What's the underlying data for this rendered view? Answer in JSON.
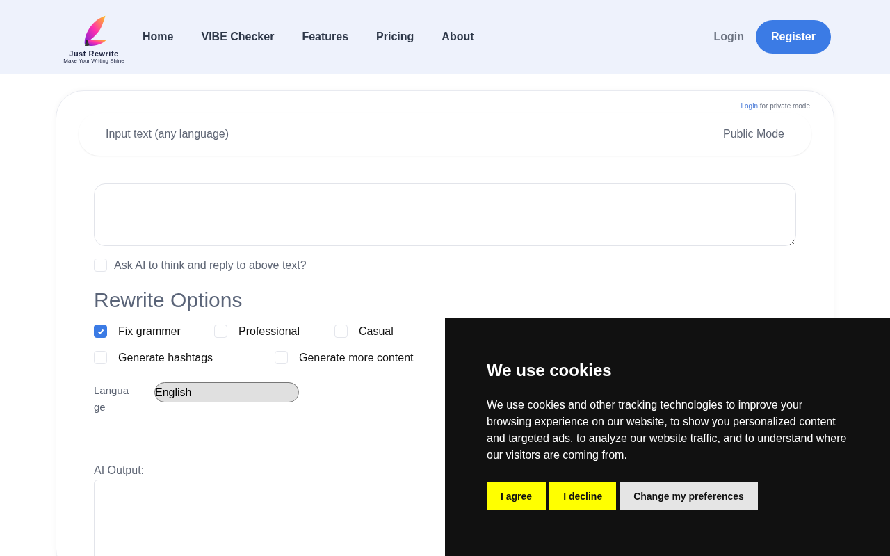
{
  "header": {
    "logo": {
      "name": "Just Rewrite",
      "tagline": "Make Your Writing Shine"
    },
    "nav": [
      {
        "label": "Home"
      },
      {
        "label": "VIBE Checker"
      },
      {
        "label": "Features"
      },
      {
        "label": "Pricing"
      },
      {
        "label": "About"
      }
    ],
    "login": "Login",
    "register": "Register"
  },
  "input_panel": {
    "private_link": "Login",
    "private_note": "for private mode",
    "title": "Input text (any language)",
    "mode": "Public Mode"
  },
  "ask_ai": {
    "label": "Ask AI to think and reply to above text?",
    "checked": false
  },
  "rewrite_options": {
    "heading": "Rewrite Options",
    "options": [
      {
        "label": "Fix grammer",
        "checked": true
      },
      {
        "label": "Professional",
        "checked": false
      },
      {
        "label": "Casual",
        "checked": false
      },
      {
        "label": "Generate hashtags",
        "checked": false
      },
      {
        "label": "Generate more content",
        "checked": false
      }
    ]
  },
  "language": {
    "label": "Language",
    "value": "English"
  },
  "output": {
    "label": "AI Output:"
  },
  "cookie_banner": {
    "title": "We use cookies",
    "text": "We use cookies and other tracking technologies to improve your browsing experience on our website, to show you personalized content and targeted ads, to analyze our website traffic, and to understand where our visitors are coming from.",
    "buttons": [
      {
        "label": "I agree",
        "kind": "accent"
      },
      {
        "label": "I decline",
        "kind": "accent"
      },
      {
        "label": "Change my preferences",
        "kind": "plain"
      }
    ]
  }
}
